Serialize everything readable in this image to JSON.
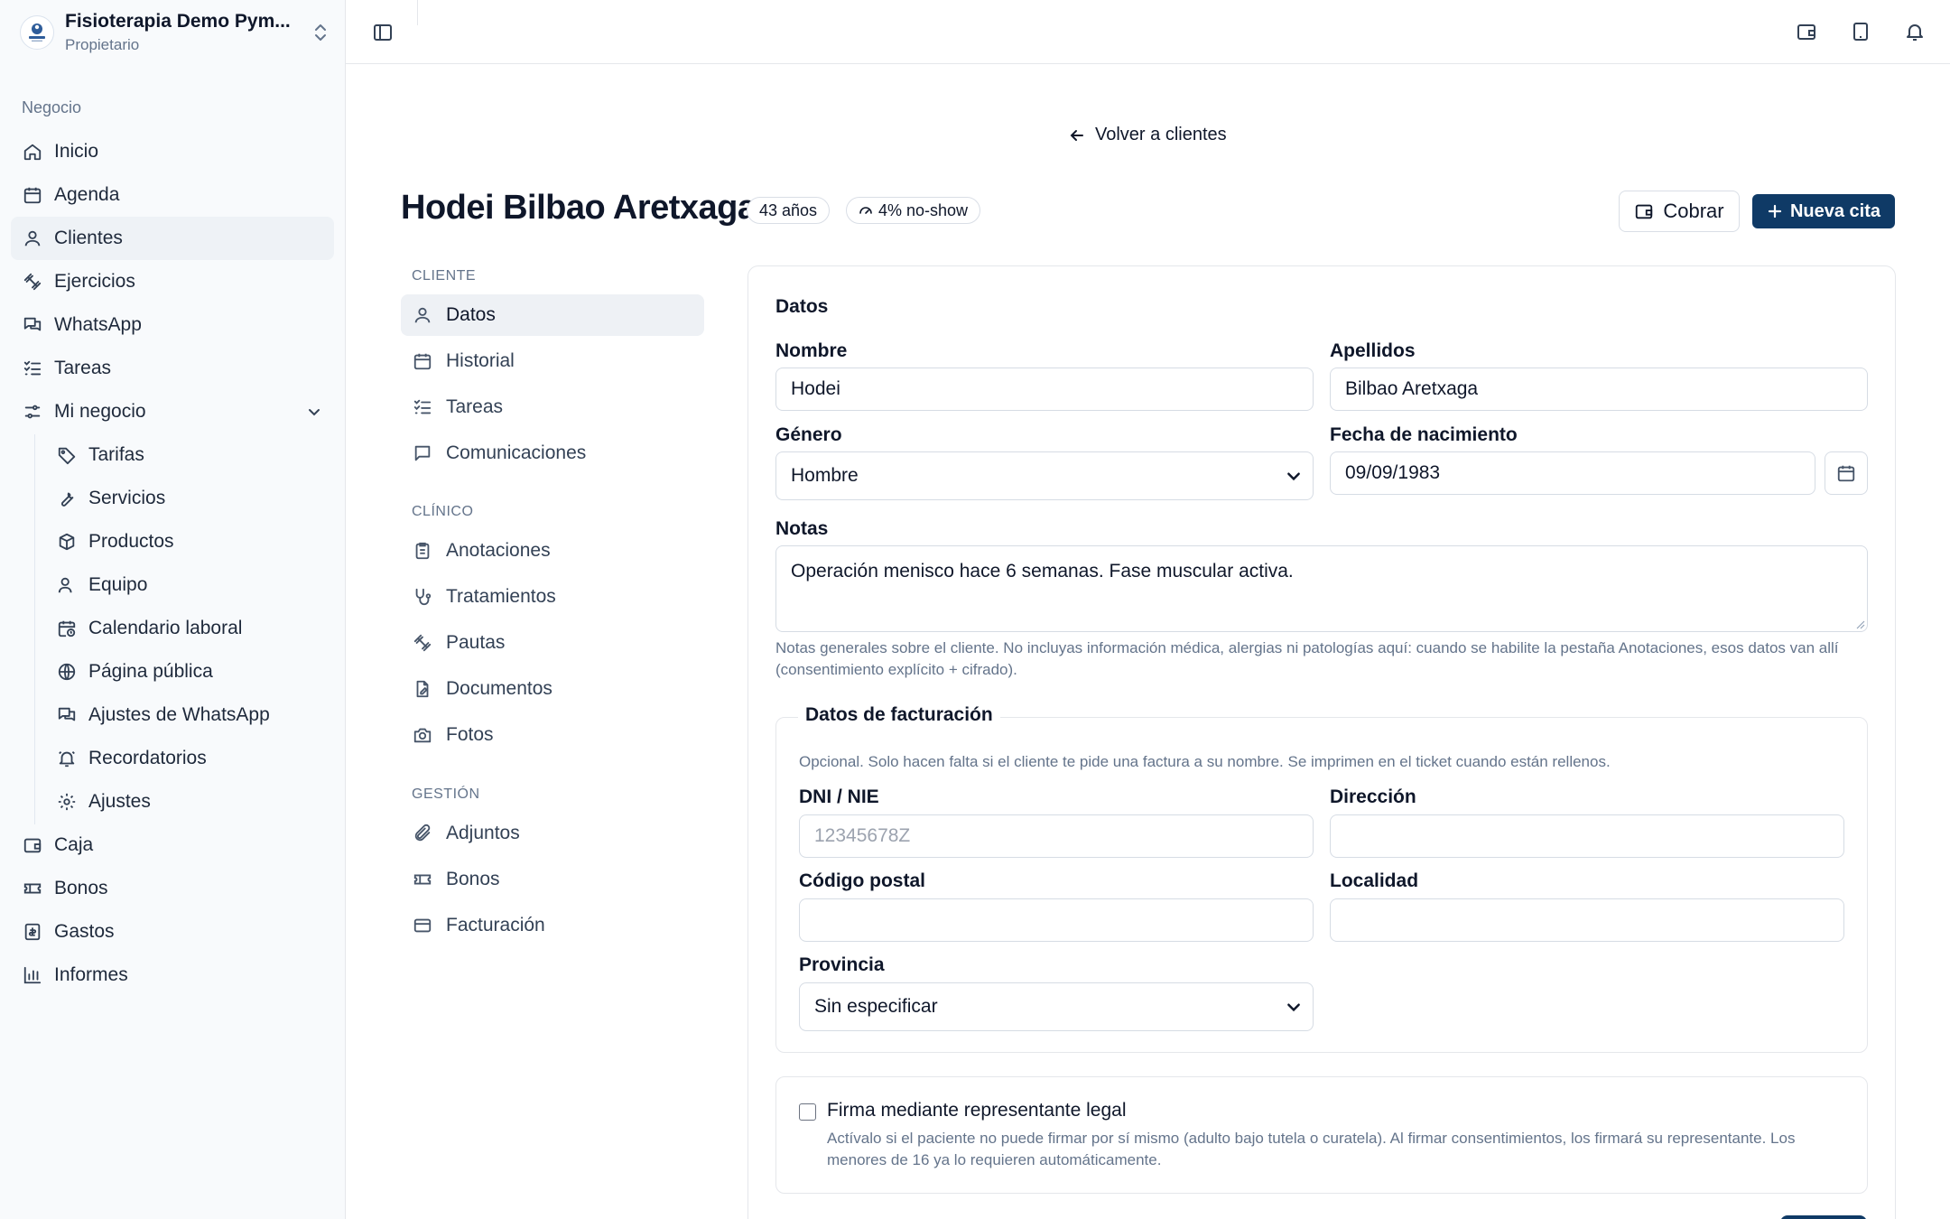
{
  "org": {
    "name": "Fisioterapia Demo Pym...",
    "role": "Propietario"
  },
  "sidebar": {
    "group_title": "Negocio",
    "items": [
      {
        "label": "Inicio",
        "icon": "home-icon"
      },
      {
        "label": "Agenda",
        "icon": "calendar-icon"
      },
      {
        "label": "Clientes",
        "icon": "user-icon",
        "active": true
      },
      {
        "label": "Ejercicios",
        "icon": "dumbbell-icon"
      },
      {
        "label": "WhatsApp",
        "icon": "chat-icon"
      },
      {
        "label": "Tareas",
        "icon": "list-check-icon"
      },
      {
        "label": "Mi negocio",
        "icon": "sliders-icon",
        "expanded": true
      }
    ],
    "sub_items": [
      {
        "label": "Tarifas",
        "icon": "tag-icon"
      },
      {
        "label": "Servicios",
        "icon": "wrench-icon"
      },
      {
        "label": "Productos",
        "icon": "box-icon"
      },
      {
        "label": "Equipo",
        "icon": "users-icon"
      },
      {
        "label": "Calendario laboral",
        "icon": "calendar-clock-icon"
      },
      {
        "label": "Página pública",
        "icon": "globe-icon"
      },
      {
        "label": "Ajustes de WhatsApp",
        "icon": "chat-settings-icon"
      },
      {
        "label": "Recordatorios",
        "icon": "bell-ring-icon"
      },
      {
        "label": "Ajustes",
        "icon": "gear-icon"
      }
    ],
    "bottom_items": [
      {
        "label": "Caja",
        "icon": "wallet-icon"
      },
      {
        "label": "Bonos",
        "icon": "ticket-icon"
      },
      {
        "label": "Gastos",
        "icon": "receipt-icon"
      },
      {
        "label": "Informes",
        "icon": "bar-chart-icon"
      }
    ]
  },
  "back_link": "Volver a clientes",
  "client": {
    "name": "Hodei Bilbao Aretxaga",
    "age_badge": "43 años",
    "noshow_badge": "4% no-show"
  },
  "actions": {
    "charge": "Cobrar",
    "new_appointment": "Nueva cita"
  },
  "client_nav": {
    "sections": [
      {
        "title": "CLIENTE",
        "items": [
          "Datos",
          "Historial",
          "Tareas",
          "Comunicaciones"
        ]
      },
      {
        "title": "CLÍNICO",
        "items": [
          "Anotaciones",
          "Tratamientos",
          "Pautas",
          "Documentos",
          "Fotos"
        ]
      },
      {
        "title": "GESTIÓN",
        "items": [
          "Adjuntos",
          "Bonos",
          "Facturación"
        ]
      }
    ],
    "active": "Datos"
  },
  "form": {
    "section_title": "Datos",
    "nombre_label": "Nombre",
    "nombre_value": "Hodei",
    "apellidos_label": "Apellidos",
    "apellidos_value": "Bilbao Aretxaga",
    "genero_label": "Género",
    "genero_value": "Hombre",
    "fecha_label": "Fecha de nacimiento",
    "fecha_value": "09/09/1983",
    "notas_label": "Notas",
    "notas_value": "Operación menisco hace 6 semanas. Fase muscular activa.",
    "notas_help": "Notas generales sobre el cliente. No incluyas información médica, alergias ni patologías aquí: cuando se habilite la pestaña Anotaciones, esos datos van allí (consentimiento explícito + cifrado).",
    "billing": {
      "legend": "Datos de facturación",
      "help": "Opcional. Solo hacen falta si el cliente te pide una factura a su nombre. Se imprimen en el ticket cuando están rellenos.",
      "dni_label": "DNI / NIE",
      "dni_placeholder": "12345678Z",
      "direccion_label": "Dirección",
      "cp_label": "Código postal",
      "localidad_label": "Localidad",
      "provincia_label": "Provincia",
      "provincia_value": "Sin especificar"
    },
    "legal": {
      "label": "Firma mediante representante legal",
      "help": "Actívalo si el paciente no puede firmar por sí mismo (adulto bajo tutela o curatela). Al firmar consentimientos, los firmará su representante. Los menores de 16 ya lo requieren automáticamente.",
      "checked": false
    }
  }
}
